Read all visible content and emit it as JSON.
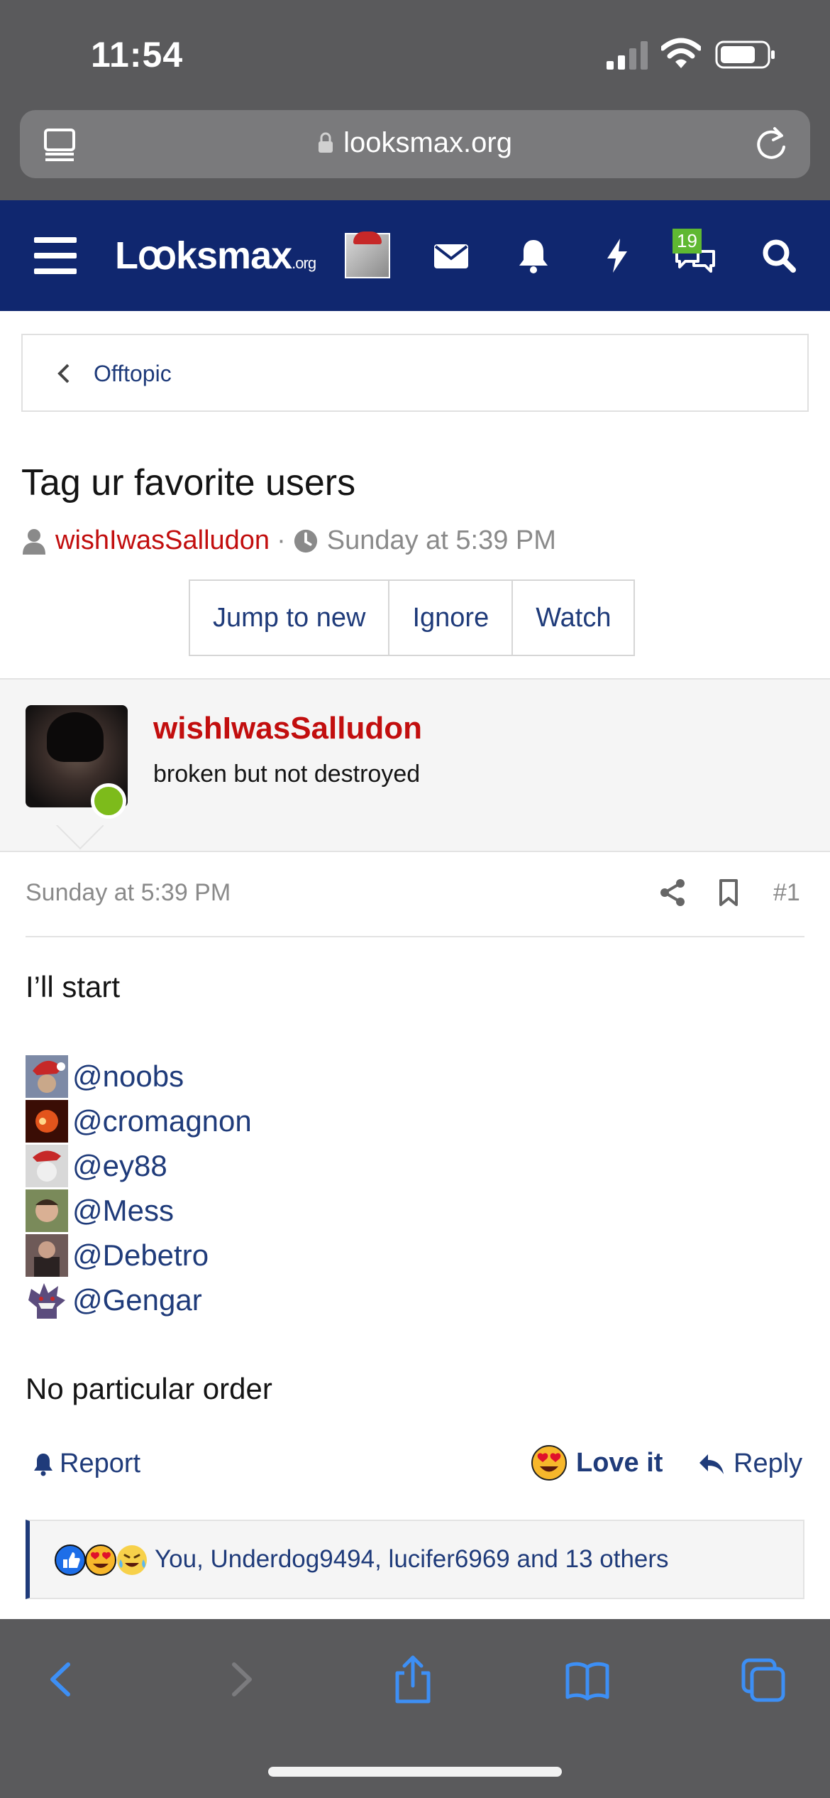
{
  "status_bar": {
    "time": "11:54"
  },
  "browser": {
    "url": "looksmax.org"
  },
  "forum_header": {
    "logo_text": "Lꝏksmax",
    "logo_suffix": ".org",
    "conversations_badge": "19"
  },
  "breadcrumb": {
    "label": "Offtopic"
  },
  "thread": {
    "title": "Tag ur favorite users",
    "author": "wishIwasSalludon",
    "separator": "·",
    "date": "Sunday at 5:39 PM",
    "buttons": [
      "Jump to new",
      "Ignore",
      "Watch"
    ]
  },
  "post": {
    "username": "wishIwasSalludon",
    "user_title": "broken but not destroyed",
    "date": "Sunday at 5:39 PM",
    "number": "#1",
    "intro": "I’ll start",
    "mentions": [
      "@noobs",
      "@cromagnon",
      "@ey88",
      "@Mess",
      "@Debetro",
      "@Gengar"
    ],
    "outro": "No particular order",
    "actions": {
      "report": "Report",
      "love": "Love it",
      "reply": "Reply"
    },
    "reactions_text": "You, Underdog9494, lucifer6969 and 13 others"
  },
  "colors": {
    "header_bg": "#10276f",
    "link": "#1f3b7a",
    "username": "#c20e0e",
    "online": "#7dbb1b",
    "badge": "#5fb832"
  }
}
